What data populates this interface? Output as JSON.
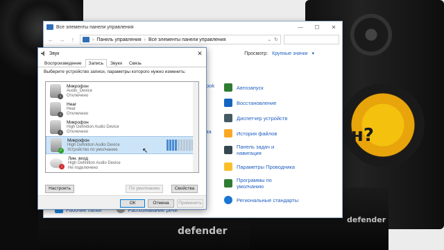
{
  "background": {
    "brand_left": "defender",
    "brand_right": "defender",
    "overlay_text": "я\nон?"
  },
  "control_panel": {
    "title": "Все элементы панели управления",
    "breadcrumb": [
      "Панель управления",
      "Все элементы панели управления"
    ],
    "view_label": "Просмотр:",
    "view_value": "Крупные значки",
    "partial_column": [
      "ook",
      "",
      "",
      "за",
      "",
      ""
    ],
    "items": [
      {
        "label": "Автозапуск",
        "icon": "autoplay-icon",
        "color": "#2e7d32"
      },
      {
        "label": "Восстановление",
        "icon": "recovery-icon",
        "color": "#1565c0"
      },
      {
        "label": "Диспетчер устройств",
        "icon": "device-manager-icon",
        "color": "#455a64"
      },
      {
        "label": "История файлов",
        "icon": "file-history-icon",
        "color": "#f9a825"
      },
      {
        "label": "Панель задач и навигация",
        "icon": "taskbar-icon",
        "color": "#37474f"
      },
      {
        "label": "Параметры Проводника",
        "icon": "folder-options-icon",
        "color": "#f9c02b"
      },
      {
        "label": "Программы по умолчанию",
        "icon": "default-programs-icon",
        "color": "#2e7d32"
      },
      {
        "label": "Региональные стандарты",
        "icon": "region-icon",
        "color": "#1976d2"
      }
    ],
    "bottom_items": [
      "Рабочие папки",
      "Распознавание речи"
    ]
  },
  "sound_dialog": {
    "title": "Звук",
    "tabs": [
      "Воспроизведение",
      "Запись",
      "Звуки",
      "Связь"
    ],
    "active_tab": "Запись",
    "prompt": "Выберите устройство записи, параметры которого нужно изменить:",
    "devices": [
      {
        "name": "Микрофон",
        "driver": "Audio_Device",
        "status": "Отключено",
        "badge": "off"
      },
      {
        "name": "Hear",
        "driver": "Hear",
        "status": "Отключено",
        "badge": "off"
      },
      {
        "name": "Микрофон",
        "driver": "High Definition Audio Device",
        "status": "Отключено",
        "badge": "off"
      },
      {
        "name": "Микрофон",
        "driver": "High Definition Audio Device",
        "status": "Устройство по умолчанию",
        "badge": "ok",
        "selected": true
      },
      {
        "name": "Лин. вход",
        "driver": "High Definition Audio Device",
        "status": "Не подключено",
        "badge": "no"
      }
    ],
    "buttons": {
      "configure": "Настроить",
      "set_default": "По умолчанию",
      "properties": "Свойства",
      "ok": "ОК",
      "cancel": "Отмена",
      "apply": "Применить"
    }
  }
}
